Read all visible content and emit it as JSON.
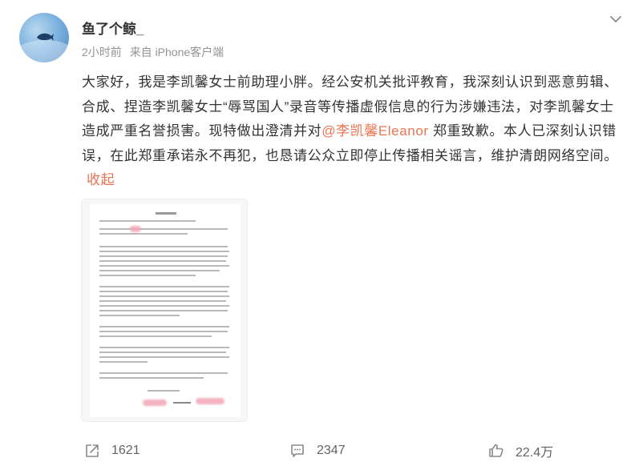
{
  "user": {
    "name": "鱼了个鲸_",
    "time": "2小时前",
    "source": "来自 iPhone客户端"
  },
  "post": {
    "text_before_mention": "大家好，我是李凯馨女士前助理小胖。经公安机关批评教育，我深刻认识到恶意剪辑、合成、捏造李凯馨女士“辱骂国人”录音等传播虚假信息的行为涉嫌违法，对李凯馨女士造成严重名誉损害。现特做出澄清并对",
    "mention": "@李凯馨Eleanor",
    "text_after_mention": " 郑重致歉。本人已深刻认识错误，在此郑重承诺永不再犯，也恳请公众立即停止传播相关谣言，维护清朗网络空间。",
    "collapse_label": "收起"
  },
  "actions": {
    "repost_count": "1621",
    "comment_count": "2347",
    "like_count": "22.4万"
  },
  "icons": {
    "more": "chevron-down-icon",
    "repost": "share-icon",
    "comment": "comment-icon",
    "like": "thumbs-up-icon"
  },
  "colors": {
    "link": "#eb7350",
    "meta": "#939393",
    "text": "#333333"
  }
}
